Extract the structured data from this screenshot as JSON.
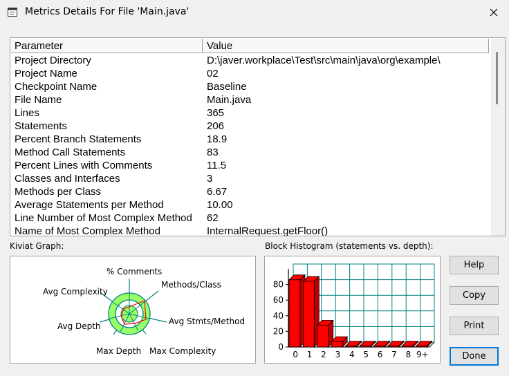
{
  "window": {
    "title": "Metrics Details For File 'Main.java'"
  },
  "table": {
    "headers": {
      "parameter": "Parameter",
      "value": "Value"
    },
    "rows": [
      {
        "param": "Project Directory",
        "value": "D:\\javer.workplace\\Test\\src\\main\\java\\org\\example\\"
      },
      {
        "param": "Project Name",
        "value": "02"
      },
      {
        "param": "Checkpoint Name",
        "value": "Baseline"
      },
      {
        "param": "File Name",
        "value": "Main.java"
      },
      {
        "param": "Lines",
        "value": "365"
      },
      {
        "param": "Statements",
        "value": "206"
      },
      {
        "param": "Percent Branch Statements",
        "value": "18.9"
      },
      {
        "param": "Method Call Statements",
        "value": "83"
      },
      {
        "param": "Percent Lines with Comments",
        "value": "11.5"
      },
      {
        "param": "Classes and Interfaces",
        "value": "3"
      },
      {
        "param": "Methods per Class",
        "value": "6.67"
      },
      {
        "param": "Average Statements per Method",
        "value": "10.00"
      },
      {
        "param": "Line Number of Most Complex Method",
        "value": "62"
      },
      {
        "param": "Name of Most Complex Method",
        "value": "InternalRequest.getFloor()"
      }
    ]
  },
  "kiviat": {
    "label": "Kiviat Graph:",
    "axes": [
      "% Comments",
      "Methods/Class",
      "Avg Stmts/Method",
      "Max Complexity",
      "Max Depth",
      "Avg Depth",
      "Avg Complexity"
    ]
  },
  "histogram": {
    "label": "Block Histogram (statements vs. depth):"
  },
  "chart_data": {
    "type": "bar",
    "title": "Block Histogram (statements vs. depth):",
    "categories": [
      "0",
      "1",
      "2",
      "3",
      "4",
      "5",
      "6",
      "7",
      "8",
      "9+"
    ],
    "values": [
      86,
      84,
      28,
      7,
      0,
      0,
      0,
      0,
      0,
      0
    ],
    "yticks": [
      "0",
      "20",
      "40",
      "60",
      "80"
    ],
    "ylim": [
      0,
      100
    ],
    "bar_color": "#ff0000",
    "grid_color": "#008080"
  },
  "buttons": {
    "help": "Help",
    "copy": "Copy",
    "print": "Print",
    "done": "Done"
  }
}
